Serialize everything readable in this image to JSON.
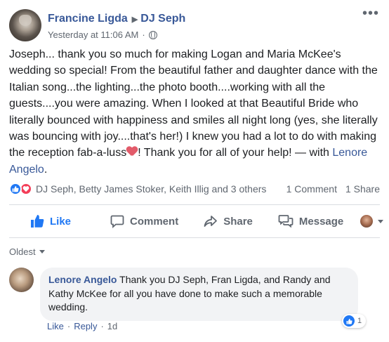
{
  "post": {
    "author": "Francine Ligda",
    "target": "DJ Seph",
    "timestamp": "Yesterday at 11:06 AM",
    "privacy_icon": "globe-icon",
    "text_main": "Joseph... thank you so much for making Logan and Maria McKee's wedding so special! From the beautiful father and daughter dance with the Italian song...the lighting...the photo booth....working with all the guests....you were amazing. When I looked at that Beautiful Bride who literally bounced with happiness and smiles all night long (yes, she literally was bouncing with joy....that's her!) I knew you had a lot to do with making the reception fab-a-luss",
    "text_after_emoji": "! Thank you for all of your help! — with ",
    "tagged": "Lenore Angelo",
    "text_end": "."
  },
  "reactions": {
    "names": "DJ Seph, Betty James Stoker, Keith Illig and 3 others",
    "comments": "1 Comment",
    "shares": "1 Share"
  },
  "actions": {
    "like": "Like",
    "comment": "Comment",
    "share": "Share",
    "message": "Message"
  },
  "comments_section": {
    "sort": "Oldest",
    "items": [
      {
        "author": "Lenore Angelo",
        "text": "Thank you DJ Seph, Fran Ligda, and Randy and Kathy McKee for all you have done to make such a memorable wedding.",
        "like": "Like",
        "reply": "Reply",
        "time": "1d",
        "reaction_count": "1"
      }
    ]
  },
  "colors": {
    "link": "#385898",
    "like_blue": "#2078f4",
    "love_red": "#f33e58",
    "muted": "#606770"
  }
}
